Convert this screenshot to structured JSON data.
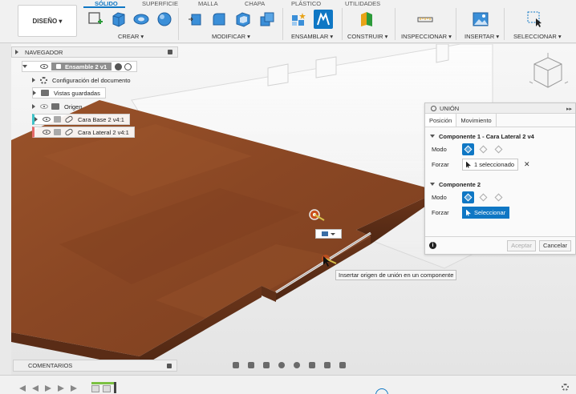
{
  "toolbar": {
    "workspace": "DISEÑO ▾",
    "tabs": [
      "SÓLIDO",
      "SUPERFICIE",
      "MALLA",
      "CHAPA",
      "PLÁSTICO",
      "UTILIDADES"
    ],
    "groups": [
      "CREAR ▾",
      "MODIFICAR ▾",
      "ENSAMBLAR ▾",
      "CONSTRUIR ▾",
      "INSPECCIONAR ▾",
      "INSERTAR ▾",
      "SELECCIONAR ▾"
    ]
  },
  "navigator": {
    "title": "NAVEGADOR",
    "items": [
      "Ensamble 2 v1",
      "Configuración del documento",
      "Vistas guardadas",
      "Origen",
      "Cara Base 2 v4:1",
      "Cara Lateral 2 v4:1"
    ]
  },
  "union_panel": {
    "title": "UNIÓN",
    "tabs": [
      "Posición",
      "Movimiento"
    ],
    "component1": {
      "heading": "Componente 1 - Cara Lateral 2 v4",
      "mode_label": "Modo",
      "snap_label": "Forzar",
      "selection": "1 seleccionado"
    },
    "component2": {
      "heading": "Componente 2",
      "mode_label": "Modo",
      "snap_label": "Forzar",
      "selection": "Seleccionar"
    },
    "ok": "Aceptar",
    "cancel": "Cancelar"
  },
  "tooltip": "Insertar origen de unión en un componente",
  "comments": "COMENTARIOS",
  "colors": {
    "accent": "#0f77c4",
    "wood": "#8d4a26"
  }
}
